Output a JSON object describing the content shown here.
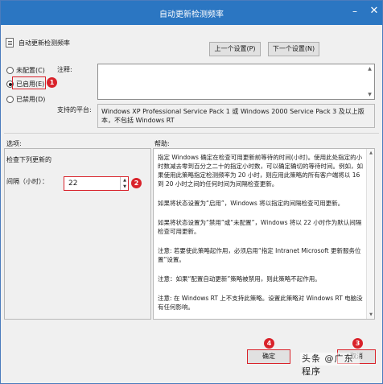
{
  "window": {
    "title": "自动更新检测频率",
    "minimize_icon": "minimize-icon",
    "close_icon": "close-icon"
  },
  "header": {
    "policy_name": "自动更新检测频率",
    "prev_label": "上一个设置(P)",
    "next_label": "下一个设置(N)"
  },
  "state": {
    "not_configured": "未配置(C)",
    "enabled": "已启用(E)",
    "disabled": "已禁用(D)",
    "selected": "enabled"
  },
  "comment": {
    "label": "注释:",
    "value": ""
  },
  "platform": {
    "label": "支持的平台:",
    "value": "Windows XP Professional Service Pack 1 或 Windows 2000 Service Pack 3 及以上版本，不包括 Windows RT"
  },
  "options": {
    "section_label": "选项:",
    "detect_label": "检查下列更新的",
    "interval_label": "间隔（小时）：",
    "interval_value": "22"
  },
  "help": {
    "section_label": "帮助:",
    "paragraphs": [
      "指定 Windows 确定在检查可用更新前等待的时间(小时)。使用此处指定的小时数减去零到百分之二十的指定小时数，可以确定确切的等待时间。例如，如果使用此策略指定检测频率为 20 小时，则应用此策略的所有客户端将以 16 到 20 小时之间的任何时间为间隔检查更新。",
      "如果将状态设置为“启用”，Windows 将以指定的间隔检查可用更新。",
      "如果将状态设置为“禁用”或“未配置”，Windows 将以 22 小时作为默认间隔检查可用更新。",
      "注意: 若要使此策略起作用，必须启用“指定 Intranet Microsoft 更新服务位置”设置。",
      "注意：如果“配置自动更新”策略被禁用，则此策略不起作用。",
      "注意: 在 Windows RT 上不支持此策略。设置此策略对 Windows RT 电脑没有任何影响。"
    ]
  },
  "footer": {
    "ok_label": "确定",
    "cancel_label": "取消",
    "watermark": "头条 @广东程序"
  },
  "markers": [
    "1",
    "2",
    "3",
    "4"
  ],
  "colors": {
    "titlebar": "#2b76c2",
    "annotation_red": "#d9222a",
    "window_bg": "#f0f0f0"
  }
}
